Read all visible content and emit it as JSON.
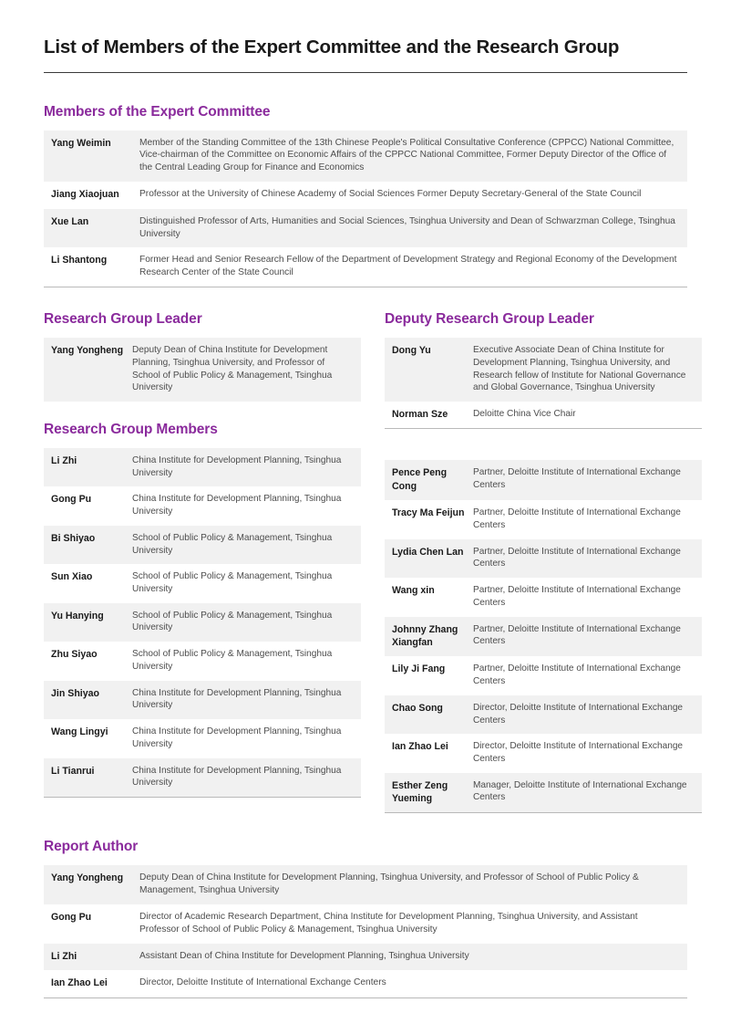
{
  "document": {
    "title": "List of Members of the Expert Committee and the Research Group",
    "accent_color": "#8a2a9c",
    "zebra_color": "#f1f1f1",
    "rule_color": "#b9b9b9"
  },
  "expert_committee": {
    "heading": "Members of the Expert Committee",
    "rows": [
      {
        "name": "Yang Weimin",
        "desc": "Member of the Standing Committee of the 13th Chinese People's Political Consultative Conference (CPPCC) National Committee, Vice-chairman of the Committee on Economic Affairs of the CPPCC National Committee, Former Deputy Director of the Office of the Central Leading Group for Finance and Economics"
      },
      {
        "name": "Jiang Xiaojuan",
        "desc": "Professor at the University of Chinese Academy of Social Sciences Former Deputy Secretary-General of the State Council"
      },
      {
        "name": "Xue Lan",
        "desc": "Distinguished Professor of Arts, Humanities and Social Sciences, Tsinghua University and Dean of Schwarzman College, Tsinghua University"
      },
      {
        "name": "Li Shantong",
        "desc": "Former Head and Senior Research Fellow of the Department of Development Strategy and Regional Economy of the Development Research Center of the State Council"
      }
    ]
  },
  "group_leader": {
    "heading": "Research Group Leader",
    "rows": [
      {
        "name": "Yang Yongheng",
        "desc": "Deputy Dean of China Institute for Development Planning, Tsinghua University, and Professor of School of Public Policy & Management, Tsinghua University"
      }
    ]
  },
  "deputy_group_leader": {
    "heading": "Deputy Research Group Leader",
    "rows": [
      {
        "name": "Dong Yu",
        "desc": "Executive Associate Dean of China Institute for Development Planning, Tsinghua University, and Research fellow of Institute for National Governance and Global Governance, Tsinghua University"
      },
      {
        "name": "Norman Sze",
        "desc": "Deloitte China Vice Chair"
      }
    ]
  },
  "group_members": {
    "heading": "Research Group Members",
    "left_rows": [
      {
        "name": "Li Zhi",
        "desc": "China Institute for Development Planning, Tsinghua University"
      },
      {
        "name": "Gong Pu",
        "desc": "China Institute for Development Planning, Tsinghua University"
      },
      {
        "name": "Bi Shiyao",
        "desc": "School of Public Policy & Management, Tsinghua University"
      },
      {
        "name": "Sun Xiao",
        "desc": "School of Public Policy & Management, Tsinghua University"
      },
      {
        "name": "Yu Hanying",
        "desc": "School of Public Policy & Management, Tsinghua University"
      },
      {
        "name": "Zhu Siyao",
        "desc": "School of Public Policy & Management, Tsinghua University"
      },
      {
        "name": "Jin Shiyao",
        "desc": "China Institute for Development Planning, Tsinghua University"
      },
      {
        "name": "Wang Lingyi",
        "desc": "China Institute for Development Planning, Tsinghua University"
      },
      {
        "name": "Li Tianrui",
        "desc": "China Institute for Development Planning, Tsinghua University"
      }
    ],
    "right_rows": [
      {
        "name": "Pence Peng Cong",
        "desc": "Partner, Deloitte Institute of International Exchange Centers"
      },
      {
        "name": "Tracy Ma Feijun",
        "desc": "Partner, Deloitte Institute of International Exchange Centers"
      },
      {
        "name": "Lydia Chen Lan",
        "desc": "Partner, Deloitte Institute of International Exchange Centers"
      },
      {
        "name": "Wang xin",
        "desc": "Partner, Deloitte Institute of International Exchange Centers"
      },
      {
        "name": "Johnny Zhang Xiangfan",
        "desc": "Partner, Deloitte Institute of International Exchange Centers"
      },
      {
        "name": "Lily Ji Fang",
        "desc": "Partner, Deloitte Institute of International Exchange Centers"
      },
      {
        "name": "Chao Song",
        "desc": "Director, Deloitte Institute of International Exchange Centers"
      },
      {
        "name": "Ian Zhao Lei",
        "desc": "Director, Deloitte Institute of International Exchange Centers"
      },
      {
        "name": "Esther Zeng Yueming",
        "desc": "Manager, Deloitte Institute of International Exchange Centers"
      }
    ]
  },
  "report_author": {
    "heading": "Report Author",
    "rows": [
      {
        "name": "Yang Yongheng",
        "desc": "Deputy Dean of China Institute for Development Planning, Tsinghua University, and Professor of School of Public Policy & Management, Tsinghua University"
      },
      {
        "name": "Gong Pu",
        "desc": "Director of Academic Research Department, China Institute for Development Planning, Tsinghua University, and Assistant Professor of School of Public Policy & Management, Tsinghua University"
      },
      {
        "name": "Li Zhi",
        "desc": "Assistant Dean of China Institute for Development Planning, Tsinghua University"
      },
      {
        "name": "Ian Zhao Lei",
        "desc": "Director, Deloitte Institute of International Exchange Centers"
      }
    ]
  }
}
